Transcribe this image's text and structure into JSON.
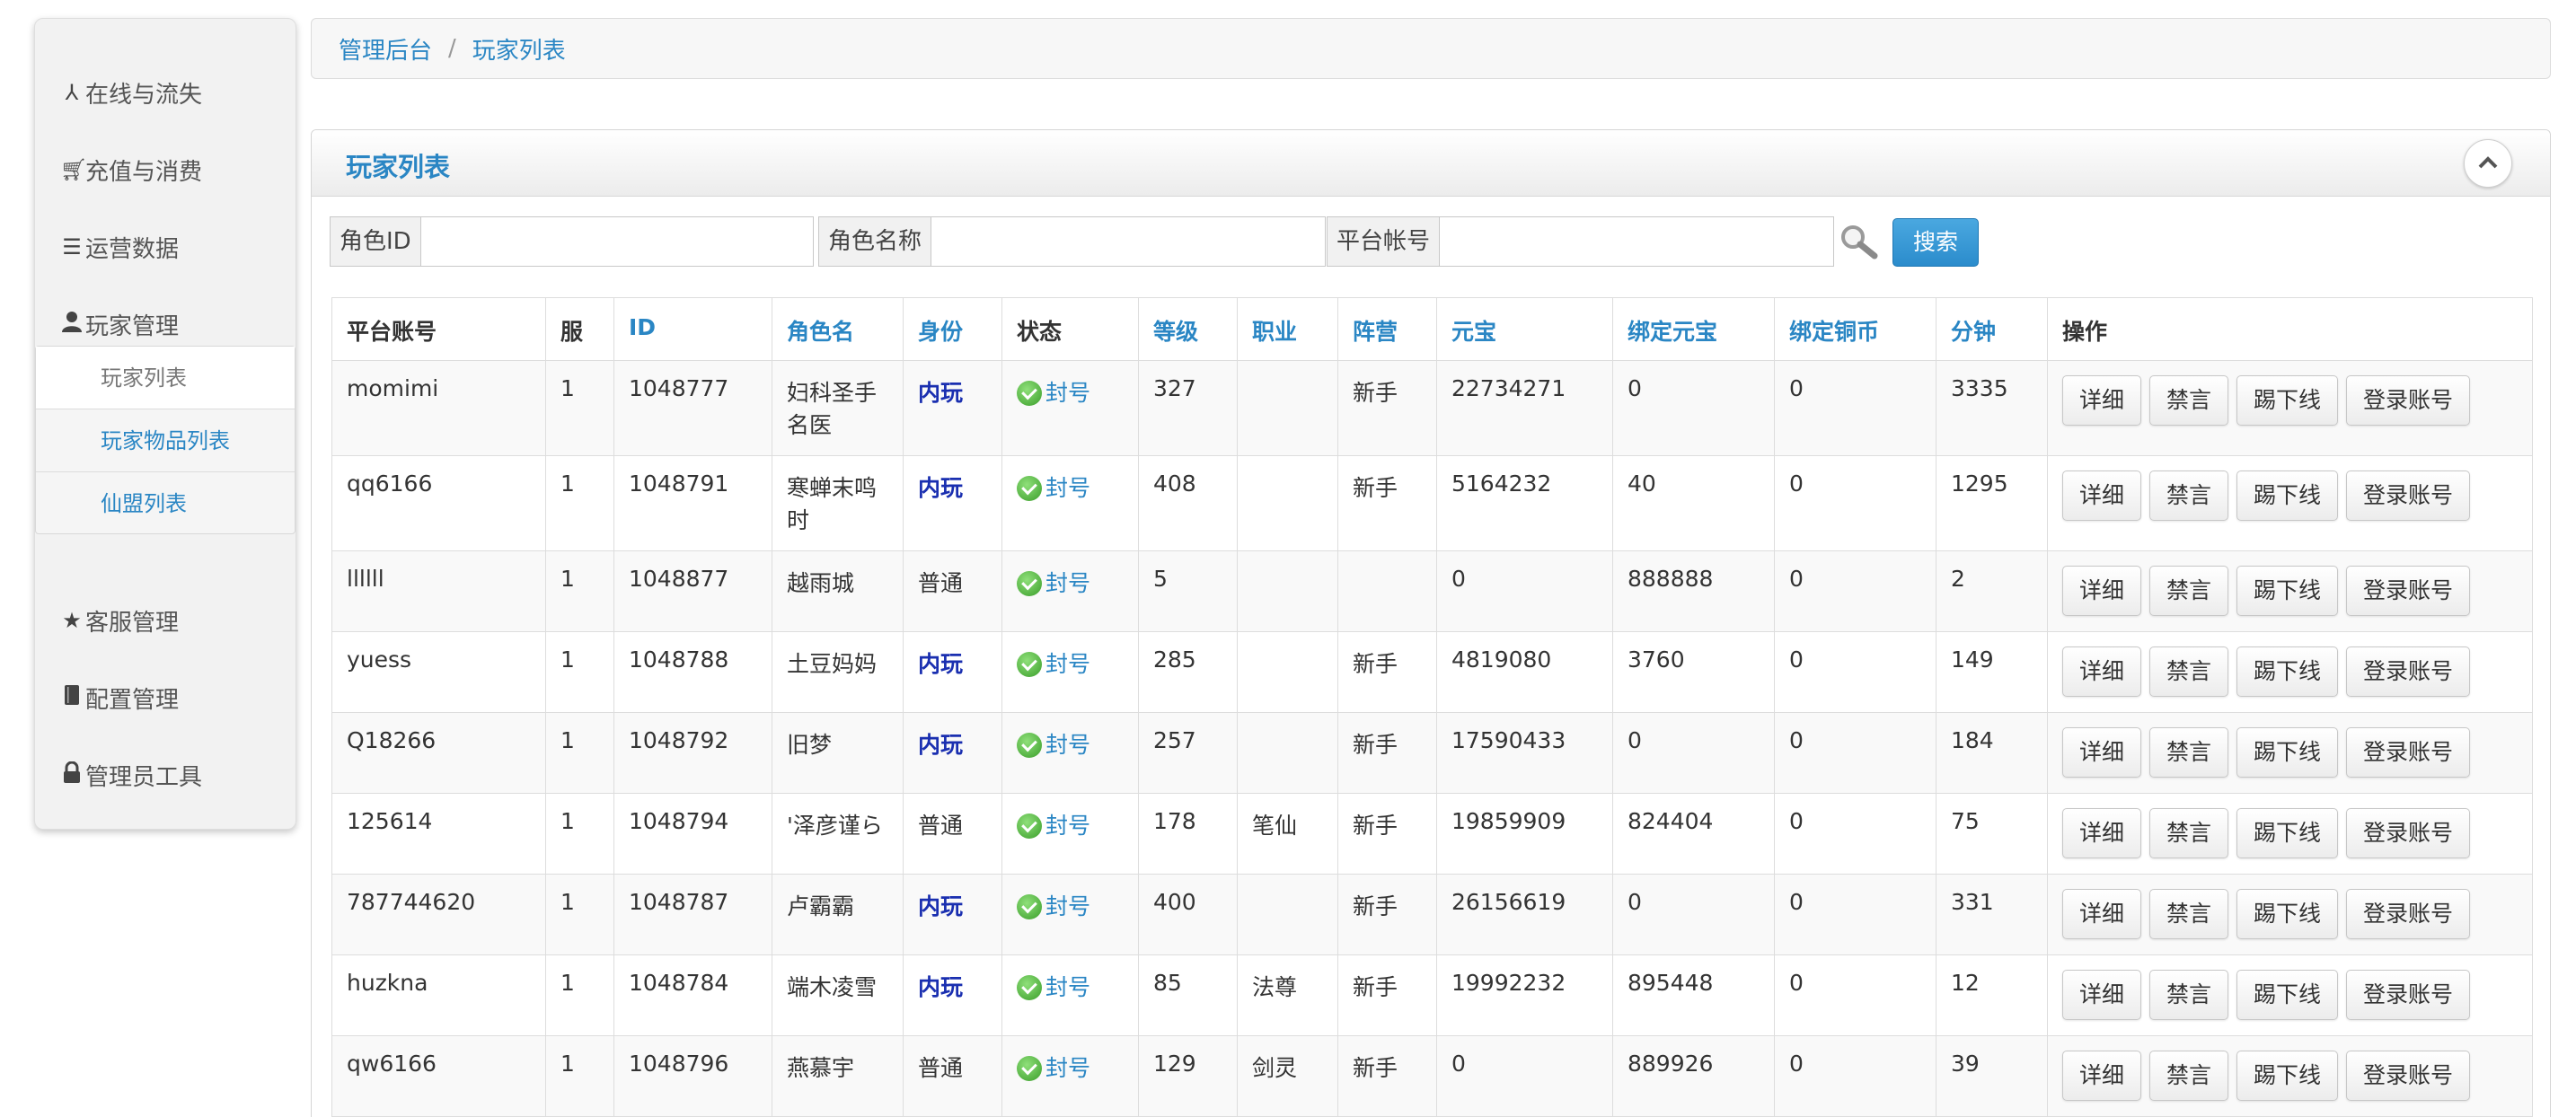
{
  "sidebar": {
    "items": [
      {
        "label": "在线与流失",
        "icon": "user-stats-icon"
      },
      {
        "label": "充值与消费",
        "icon": "cart-icon"
      },
      {
        "label": "运营数据",
        "icon": "list-icon"
      },
      {
        "label": "玩家管理",
        "icon": "user-icon"
      },
      {
        "label": "客服管理",
        "icon": "star-icon"
      },
      {
        "label": "配置管理",
        "icon": "book-icon"
      },
      {
        "label": "管理员工具",
        "icon": "lock-icon"
      }
    ],
    "submenu": [
      {
        "label": "玩家列表"
      },
      {
        "label": "玩家物品列表"
      },
      {
        "label": "仙盟列表"
      }
    ]
  },
  "breadcrumb": {
    "home": "管理后台",
    "separator": "/",
    "current": "玩家列表"
  },
  "panel": {
    "title": "玩家列表"
  },
  "search": {
    "role_id_label": "角色ID",
    "role_id_value": "",
    "role_name_label": "角色名称",
    "role_name_value": "",
    "platform_account_label": "平台帐号",
    "platform_account_value": "",
    "button_label": "搜索"
  },
  "table": {
    "headers": [
      "平台账号",
      "服",
      "ID",
      "角色名",
      "身份",
      "状态",
      "等级",
      "职业",
      "阵营",
      "元宝",
      "绑定元宝",
      "绑定铜币",
      "分钟",
      "操作"
    ],
    "rows": [
      {
        "account": "momimi",
        "server": "1",
        "id": "1048777",
        "name": "妇科圣手名医",
        "identity": "内玩",
        "status": "封号",
        "level": "327",
        "job": "",
        "camp": "新手",
        "yuanbao": "22734271",
        "bound_yuanbao": "0",
        "bound_copper": "0",
        "minutes": "3335"
      },
      {
        "account": "qq6166",
        "server": "1",
        "id": "1048791",
        "name": "寒蝉末鸣时",
        "identity": "内玩",
        "status": "封号",
        "level": "408",
        "job": "",
        "camp": "新手",
        "yuanbao": "5164232",
        "bound_yuanbao": "40",
        "bound_copper": "0",
        "minutes": "1295"
      },
      {
        "account": "llllll",
        "server": "1",
        "id": "1048877",
        "name": "越雨城",
        "identity": "普通",
        "status": "封号",
        "level": "5",
        "job": "",
        "camp": "",
        "yuanbao": "0",
        "bound_yuanbao": "888888",
        "bound_copper": "0",
        "minutes": "2"
      },
      {
        "account": "yuess",
        "server": "1",
        "id": "1048788",
        "name": "土豆妈妈",
        "identity": "内玩",
        "status": "封号",
        "level": "285",
        "job": "",
        "camp": "新手",
        "yuanbao": "4819080",
        "bound_yuanbao": "3760",
        "bound_copper": "0",
        "minutes": "149"
      },
      {
        "account": "Q18266",
        "server": "1",
        "id": "1048792",
        "name": "旧梦",
        "identity": "内玩",
        "status": "封号",
        "level": "257",
        "job": "",
        "camp": "新手",
        "yuanbao": "17590433",
        "bound_yuanbao": "0",
        "bound_copper": "0",
        "minutes": "184"
      },
      {
        "account": "125614",
        "server": "1",
        "id": "1048794",
        "name": "'泽彦谨ら",
        "identity": "普通",
        "status": "封号",
        "level": "178",
        "job": "笔仙",
        "camp": "新手",
        "yuanbao": "19859909",
        "bound_yuanbao": "824404",
        "bound_copper": "0",
        "minutes": "75"
      },
      {
        "account": "787744620",
        "server": "1",
        "id": "1048787",
        "name": "卢霸霸",
        "identity": "内玩",
        "status": "封号",
        "level": "400",
        "job": "",
        "camp": "新手",
        "yuanbao": "26156619",
        "bound_yuanbao": "0",
        "bound_copper": "0",
        "minutes": "331"
      },
      {
        "account": "huzkna",
        "server": "1",
        "id": "1048784",
        "name": "端木凌雪",
        "identity": "内玩",
        "status": "封号",
        "level": "85",
        "job": "法尊",
        "camp": "新手",
        "yuanbao": "19992232",
        "bound_yuanbao": "895448",
        "bound_copper": "0",
        "minutes": "12"
      },
      {
        "account": "qw6166",
        "server": "1",
        "id": "1048796",
        "name": "燕慕宇",
        "identity": "普通",
        "status": "封号",
        "level": "129",
        "job": "剑灵",
        "camp": "新手",
        "yuanbao": "0",
        "bound_yuanbao": "889926",
        "bound_copper": "0",
        "minutes": "39"
      }
    ],
    "actions": [
      "详细",
      "禁言",
      "踢下线",
      "登录账号"
    ]
  },
  "colors": {
    "accent": "#2a86c4",
    "inner_player": "#1a2fb0",
    "status_ok": "#3a9d2a",
    "search_button": "#2b8ccc"
  }
}
